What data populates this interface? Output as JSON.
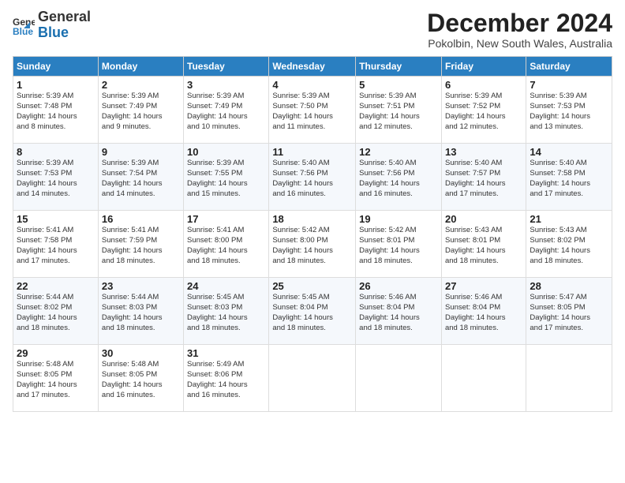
{
  "logo": {
    "general": "General",
    "blue": "Blue"
  },
  "header": {
    "title": "December 2024",
    "subtitle": "Pokolbin, New South Wales, Australia"
  },
  "weekdays": [
    "Sunday",
    "Monday",
    "Tuesday",
    "Wednesday",
    "Thursday",
    "Friday",
    "Saturday"
  ],
  "weeks": [
    [
      {
        "day": "1",
        "info": "Sunrise: 5:39 AM\nSunset: 7:48 PM\nDaylight: 14 hours\nand 8 minutes."
      },
      {
        "day": "2",
        "info": "Sunrise: 5:39 AM\nSunset: 7:49 PM\nDaylight: 14 hours\nand 9 minutes."
      },
      {
        "day": "3",
        "info": "Sunrise: 5:39 AM\nSunset: 7:49 PM\nDaylight: 14 hours\nand 10 minutes."
      },
      {
        "day": "4",
        "info": "Sunrise: 5:39 AM\nSunset: 7:50 PM\nDaylight: 14 hours\nand 11 minutes."
      },
      {
        "day": "5",
        "info": "Sunrise: 5:39 AM\nSunset: 7:51 PM\nDaylight: 14 hours\nand 12 minutes."
      },
      {
        "day": "6",
        "info": "Sunrise: 5:39 AM\nSunset: 7:52 PM\nDaylight: 14 hours\nand 12 minutes."
      },
      {
        "day": "7",
        "info": "Sunrise: 5:39 AM\nSunset: 7:53 PM\nDaylight: 14 hours\nand 13 minutes."
      }
    ],
    [
      {
        "day": "8",
        "info": "Sunrise: 5:39 AM\nSunset: 7:53 PM\nDaylight: 14 hours\nand 14 minutes."
      },
      {
        "day": "9",
        "info": "Sunrise: 5:39 AM\nSunset: 7:54 PM\nDaylight: 14 hours\nand 14 minutes."
      },
      {
        "day": "10",
        "info": "Sunrise: 5:39 AM\nSunset: 7:55 PM\nDaylight: 14 hours\nand 15 minutes."
      },
      {
        "day": "11",
        "info": "Sunrise: 5:40 AM\nSunset: 7:56 PM\nDaylight: 14 hours\nand 16 minutes."
      },
      {
        "day": "12",
        "info": "Sunrise: 5:40 AM\nSunset: 7:56 PM\nDaylight: 14 hours\nand 16 minutes."
      },
      {
        "day": "13",
        "info": "Sunrise: 5:40 AM\nSunset: 7:57 PM\nDaylight: 14 hours\nand 17 minutes."
      },
      {
        "day": "14",
        "info": "Sunrise: 5:40 AM\nSunset: 7:58 PM\nDaylight: 14 hours\nand 17 minutes."
      }
    ],
    [
      {
        "day": "15",
        "info": "Sunrise: 5:41 AM\nSunset: 7:58 PM\nDaylight: 14 hours\nand 17 minutes."
      },
      {
        "day": "16",
        "info": "Sunrise: 5:41 AM\nSunset: 7:59 PM\nDaylight: 14 hours\nand 18 minutes."
      },
      {
        "day": "17",
        "info": "Sunrise: 5:41 AM\nSunset: 8:00 PM\nDaylight: 14 hours\nand 18 minutes."
      },
      {
        "day": "18",
        "info": "Sunrise: 5:42 AM\nSunset: 8:00 PM\nDaylight: 14 hours\nand 18 minutes."
      },
      {
        "day": "19",
        "info": "Sunrise: 5:42 AM\nSunset: 8:01 PM\nDaylight: 14 hours\nand 18 minutes."
      },
      {
        "day": "20",
        "info": "Sunrise: 5:43 AM\nSunset: 8:01 PM\nDaylight: 14 hours\nand 18 minutes."
      },
      {
        "day": "21",
        "info": "Sunrise: 5:43 AM\nSunset: 8:02 PM\nDaylight: 14 hours\nand 18 minutes."
      }
    ],
    [
      {
        "day": "22",
        "info": "Sunrise: 5:44 AM\nSunset: 8:02 PM\nDaylight: 14 hours\nand 18 minutes."
      },
      {
        "day": "23",
        "info": "Sunrise: 5:44 AM\nSunset: 8:03 PM\nDaylight: 14 hours\nand 18 minutes."
      },
      {
        "day": "24",
        "info": "Sunrise: 5:45 AM\nSunset: 8:03 PM\nDaylight: 14 hours\nand 18 minutes."
      },
      {
        "day": "25",
        "info": "Sunrise: 5:45 AM\nSunset: 8:04 PM\nDaylight: 14 hours\nand 18 minutes."
      },
      {
        "day": "26",
        "info": "Sunrise: 5:46 AM\nSunset: 8:04 PM\nDaylight: 14 hours\nand 18 minutes."
      },
      {
        "day": "27",
        "info": "Sunrise: 5:46 AM\nSunset: 8:04 PM\nDaylight: 14 hours\nand 18 minutes."
      },
      {
        "day": "28",
        "info": "Sunrise: 5:47 AM\nSunset: 8:05 PM\nDaylight: 14 hours\nand 17 minutes."
      }
    ],
    [
      {
        "day": "29",
        "info": "Sunrise: 5:48 AM\nSunset: 8:05 PM\nDaylight: 14 hours\nand 17 minutes."
      },
      {
        "day": "30",
        "info": "Sunrise: 5:48 AM\nSunset: 8:05 PM\nDaylight: 14 hours\nand 16 minutes."
      },
      {
        "day": "31",
        "info": "Sunrise: 5:49 AM\nSunset: 8:06 PM\nDaylight: 14 hours\nand 16 minutes."
      },
      null,
      null,
      null,
      null
    ]
  ]
}
